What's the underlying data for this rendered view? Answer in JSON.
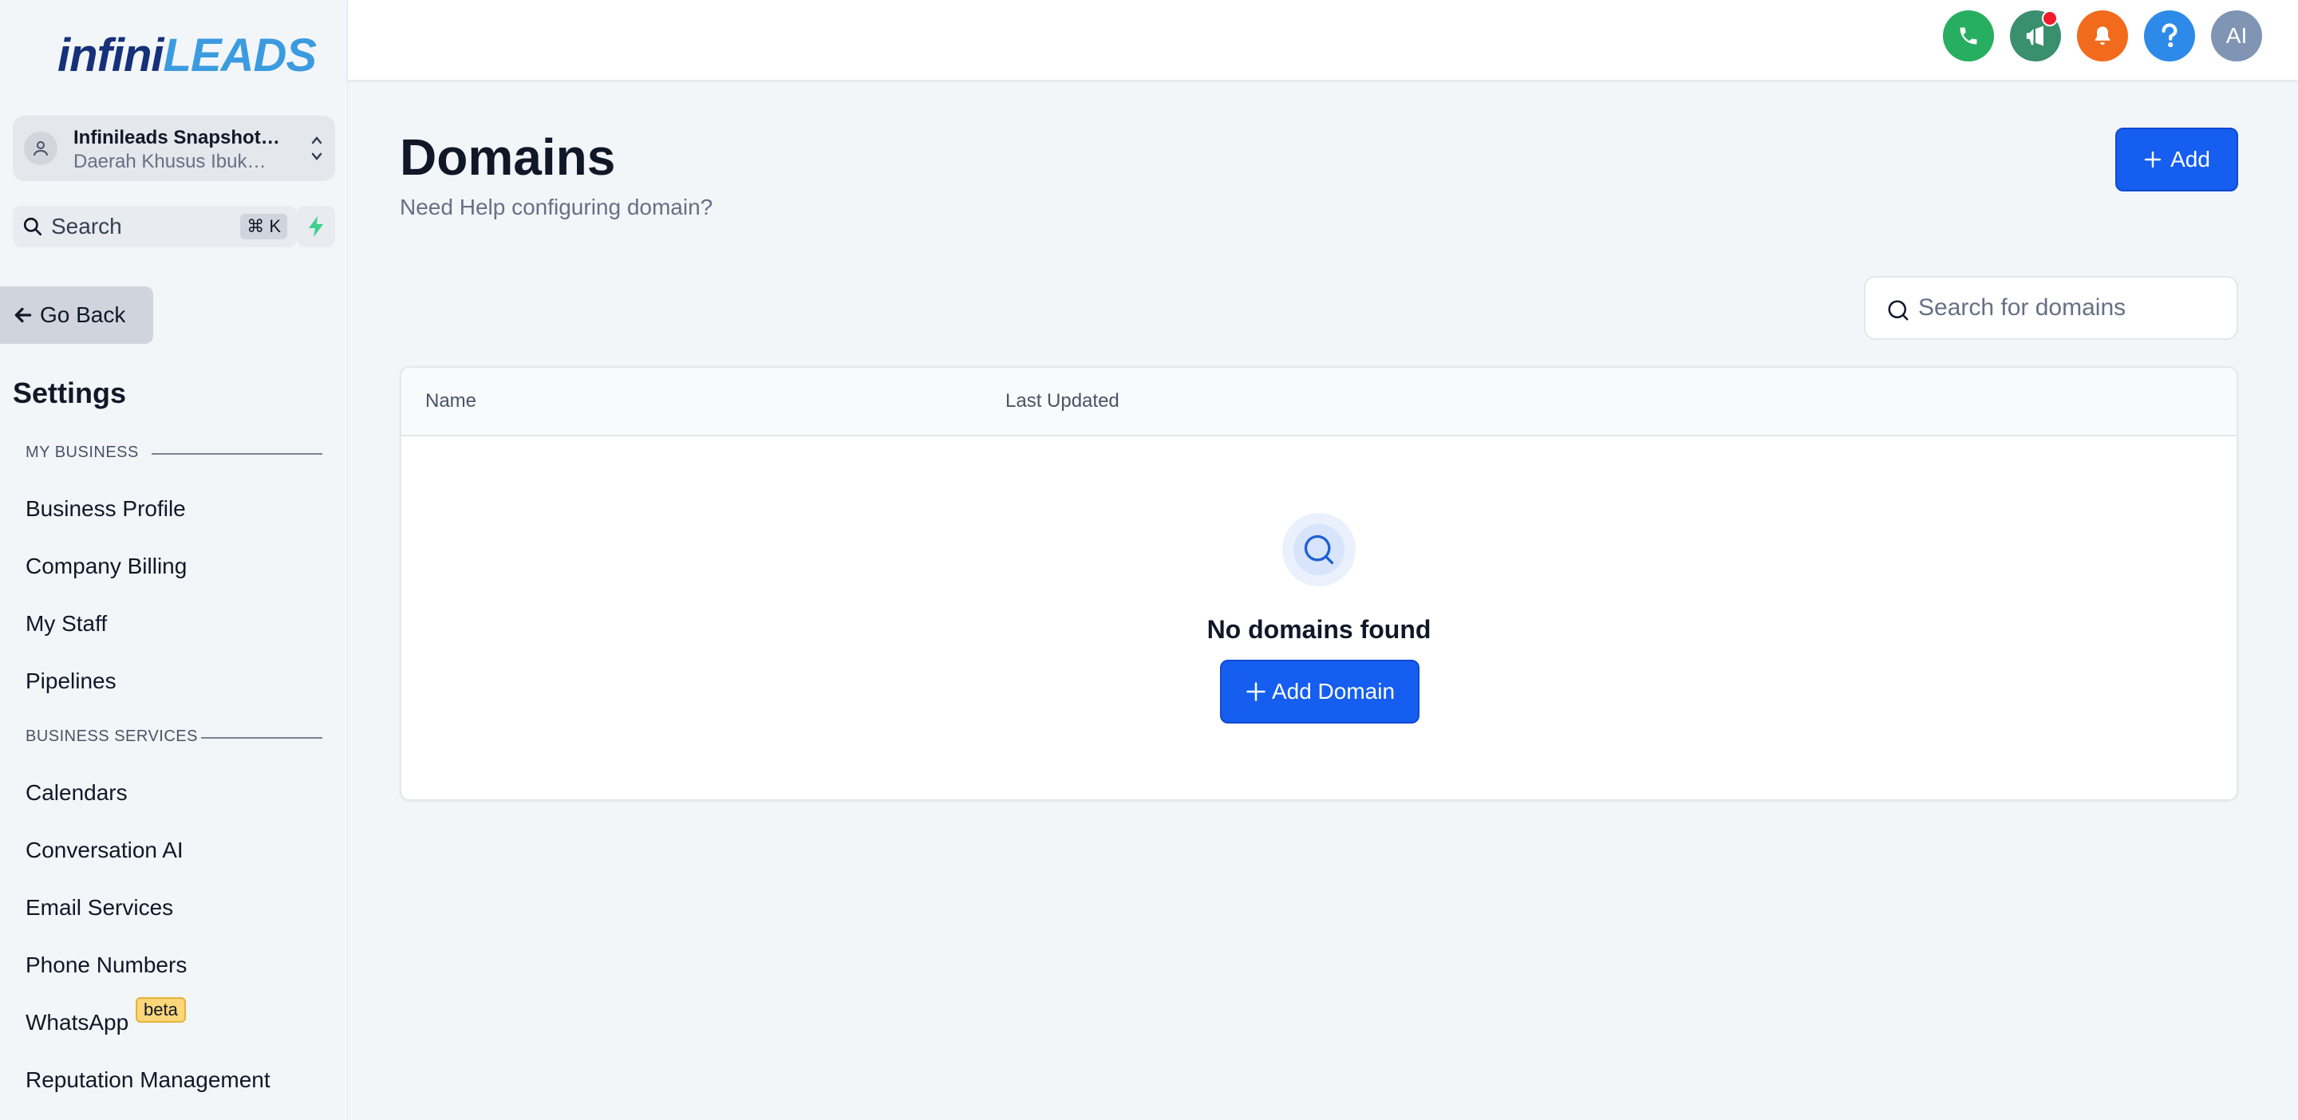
{
  "brand": {
    "logo_primary": "infini",
    "logo_accent": "LEADS",
    "colors": {
      "primary_button": "#155eef",
      "call_green": "#27ae60",
      "megaphone_teal": "#3a8f6e",
      "bell_orange": "#f26b1d",
      "help_blue": "#2d8ae8",
      "avatar_gray": "#8094b4",
      "beta_badge": "#fbd779"
    }
  },
  "account": {
    "name": "Infinileads Snapshot…",
    "location": "Daerah Khusus Ibuk…"
  },
  "sidebar": {
    "search_label": "Search",
    "search_shortcut": "⌘ K",
    "go_back": "Go Back",
    "settings_title": "Settings",
    "sections": [
      {
        "label": "MY BUSINESS",
        "items": [
          "Business Profile",
          "Company Billing",
          "My Staff",
          "Pipelines"
        ]
      },
      {
        "label": "BUSINESS SERVICES",
        "items": [
          "Calendars",
          "Conversation AI",
          "Email Services",
          "Phone Numbers",
          "WhatsApp",
          "Reputation Management"
        ]
      }
    ],
    "whatsapp_badge": "beta"
  },
  "header": {
    "icons": [
      "phone-icon",
      "megaphone-icon",
      "bell-icon",
      "help-icon"
    ],
    "avatar_initials": "AI"
  },
  "main": {
    "title": "Domains",
    "subtitle": "Need Help configuring domain?",
    "add_button": "Add",
    "search_placeholder": "Search for domains",
    "table": {
      "columns": [
        "Name",
        "Last Updated"
      ]
    },
    "empty_state": {
      "message": "No domains found",
      "button": "Add Domain"
    }
  }
}
